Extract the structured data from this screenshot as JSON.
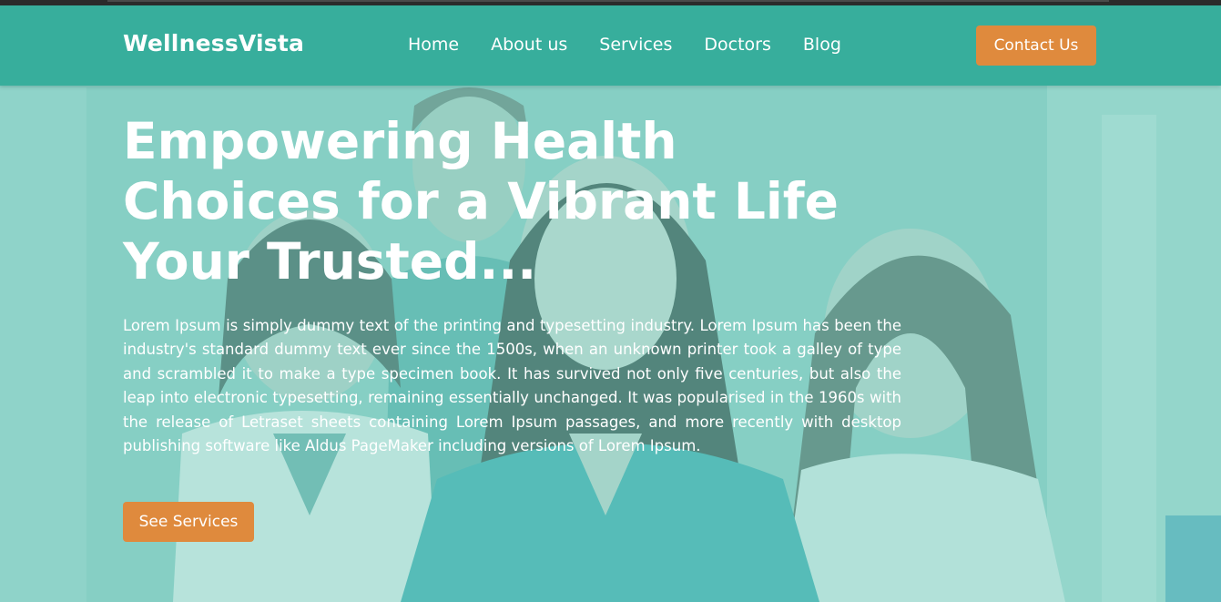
{
  "brand": {
    "name": "WellnessVista"
  },
  "nav": {
    "items": [
      {
        "label": "Home"
      },
      {
        "label": "About us"
      },
      {
        "label": "Services"
      },
      {
        "label": "Doctors"
      },
      {
        "label": "Blog"
      }
    ],
    "cta_label": "Contact Us"
  },
  "hero": {
    "title": "Empowering Health Choices for a Vibrant Life Your Trusted...",
    "paragraph": "Lorem Ipsum is simply dummy text of the printing and typesetting industry. Lorem Ipsum has been the industry's standard dummy text ever since the 1500s, when an unknown printer took a galley of type and scrambled it to make a type specimen book. It has survived not only five centuries, but also the leap into electronic typesetting, remaining essentially unchanged. It was popularised in the 1960s with the release of Letraset sheets containing Lorem Ipsum passages, and more recently with desktop publishing software like Aldus PageMaker including versions of Lorem Ipsum.",
    "button_label": "See Services"
  },
  "colors": {
    "header": "#37ae9c",
    "accent": "#df8a3d",
    "hero_tint": "#86cbc2",
    "text": "#ffffff"
  }
}
